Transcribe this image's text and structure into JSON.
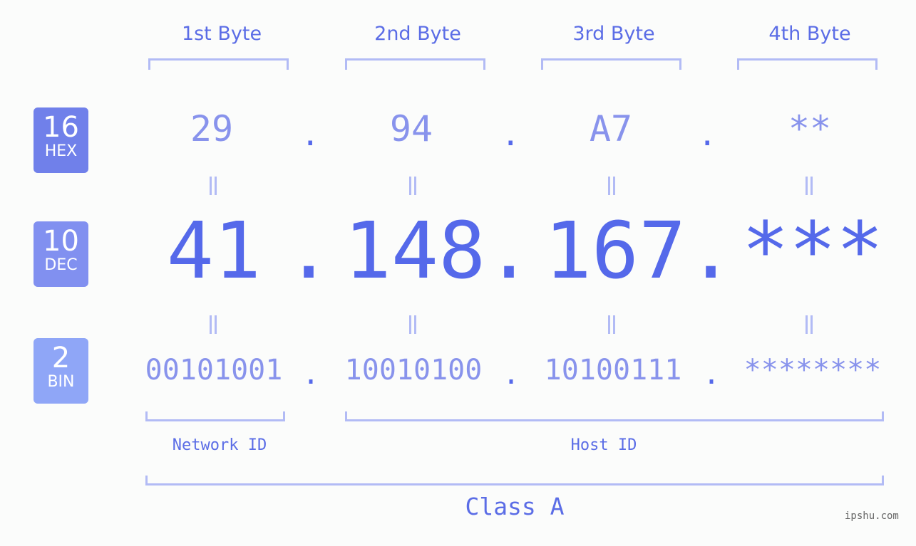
{
  "bytes": {
    "headers": [
      "1st Byte",
      "2nd Byte",
      "3rd Byte",
      "4th Byte"
    ]
  },
  "badges": {
    "hex": {
      "num": "16",
      "label": "HEX",
      "color": "#7080ea"
    },
    "dec": {
      "num": "10",
      "label": "DEC",
      "color": "#8190f0"
    },
    "bin": {
      "num": "2",
      "label": "BIN",
      "color": "#8fa6f7"
    }
  },
  "hex": {
    "values": [
      "29",
      "94",
      "A7",
      "**"
    ]
  },
  "dec": {
    "values": [
      "41",
      "148",
      "167",
      "***"
    ]
  },
  "bin": {
    "values": [
      "00101001",
      "10010100",
      "10100111",
      "********"
    ]
  },
  "separator": ".",
  "segments": {
    "network": "Network ID",
    "host": "Host ID",
    "class": "Class A"
  },
  "watermark": "ipshu.com"
}
